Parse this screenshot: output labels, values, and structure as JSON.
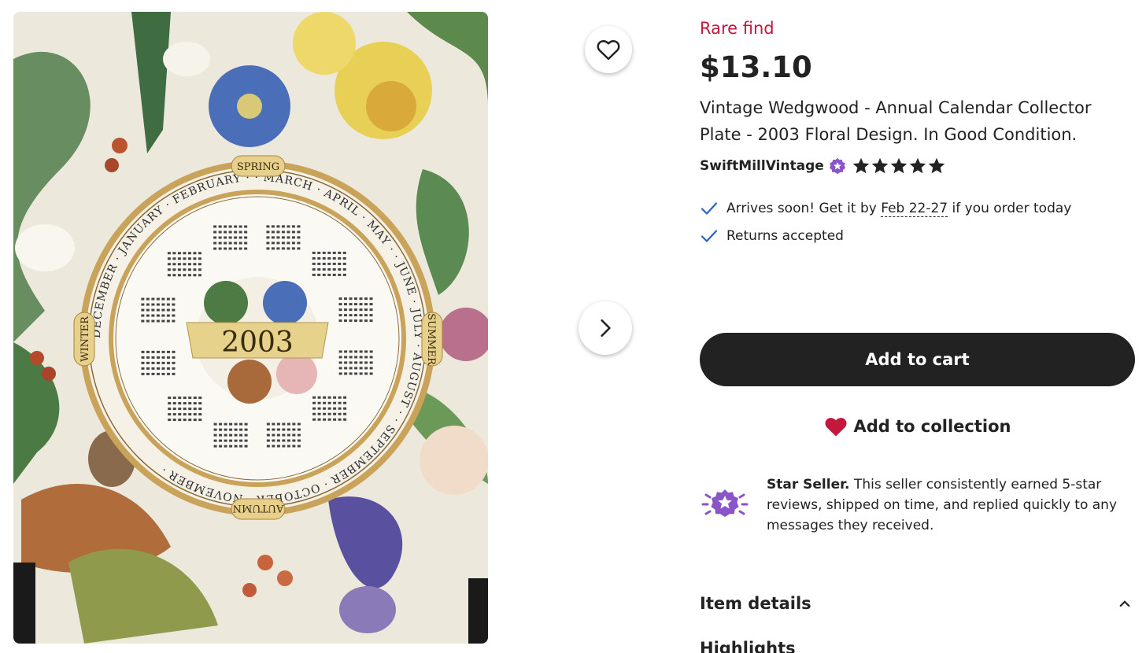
{
  "listing": {
    "rare_label": "Rare find",
    "price": "$13.10",
    "title": "Vintage Wedgwood - Annual Calendar Collector Plate - 2003 Floral Design. In Good Condition.",
    "seller": {
      "name": "SwiftMillVintage",
      "rating": 5,
      "rating_max": 5
    }
  },
  "perks": {
    "arrival_prefix": "Arrives soon! Get it by ",
    "arrival_date": "Feb 22-27",
    "arrival_suffix": " if you order today",
    "returns": "Returns accepted"
  },
  "actions": {
    "add_to_cart": "Add to cart",
    "add_to_collection": "Add to collection"
  },
  "star_seller": {
    "title": "Star Seller.",
    "text": " This seller consistently earned 5-star reviews, shipped on time, and replied quickly to any messages they received."
  },
  "sections": {
    "item_details": "Item details",
    "highlights": "Highlights"
  },
  "plate": {
    "year": "2003",
    "seasons": [
      "SPRING",
      "SUMMER",
      "AUTUMN",
      "WINTER"
    ],
    "months": [
      "JANUARY",
      "FEBRUARY",
      "MARCH",
      "APRIL",
      "MAY",
      "JUNE",
      "JULY",
      "AUGUST",
      "SEPTEMBER",
      "OCTOBER",
      "NOVEMBER",
      "DECEMBER"
    ]
  },
  "colors": {
    "accent_red": "#c4173c",
    "cart_button": "#222222",
    "star_seller_purple": "#8a55c9",
    "check_blue": "#2563c6",
    "plate_gold": "#c9a35a"
  },
  "icons": {
    "favorite": "heart-outline-icon",
    "next": "chevron-right-icon",
    "collection": "heart-filled-icon",
    "check": "checkmark-icon",
    "star_seller": "star-seller-badge-icon",
    "collapse": "chevron-up-icon"
  }
}
